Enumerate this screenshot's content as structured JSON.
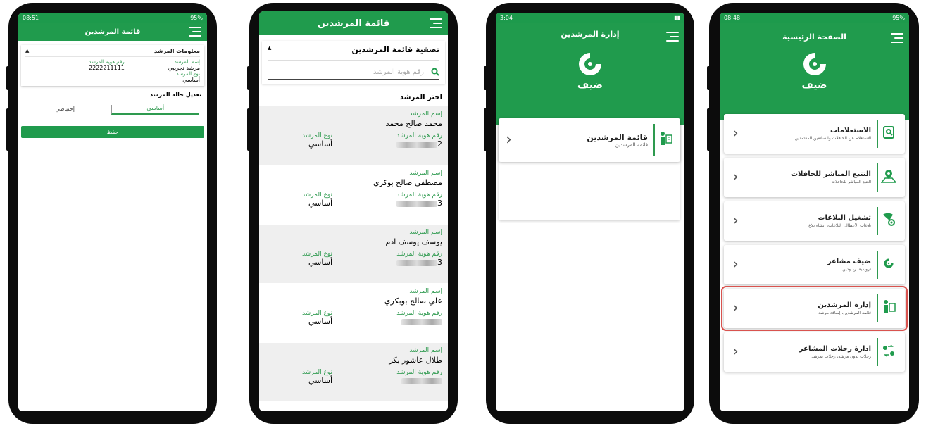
{
  "phone1": {
    "status": {
      "time": "08:51",
      "battery": "95%"
    },
    "title": "قائمة المرشدين",
    "info_title": "معلومات المرشد",
    "name_label": "إسم المرشد",
    "name_value": "مرشد تجريبي",
    "id_label": "رقم هوية المرشد",
    "id_value": "2222211111",
    "type_label": "نوع المرشد",
    "type_value": "أساسي",
    "edit_title": "تعديل حالة المرشد",
    "opt_primary": "أساسي",
    "opt_backup": "إحتياطي",
    "save": "حفظ"
  },
  "phone2": {
    "title": "قائمة المرشدين",
    "filter_title": "تصفية قائمة المرشدين",
    "search_placeholder": "رقم هوية المرشد",
    "choose": "اختر المرشد",
    "name_label": "إسم المرشد",
    "id_label": "رقم هوية المرشد",
    "type_label": "نوع المرشد",
    "items": [
      {
        "name": "محمد صالح محمد",
        "id_tail": "2",
        "type": "أساسي"
      },
      {
        "name": "مصطفى صالح بوكري",
        "id_tail": "3",
        "type": "أساسي"
      },
      {
        "name": "يوسف يوسف ادم",
        "id_tail": "3",
        "type": "أساسي"
      },
      {
        "name": "علي صالح بوبكري",
        "id_tail": "",
        "type": "أساسي"
      },
      {
        "name": "طلال عاشور بكر",
        "id_tail": "",
        "type": "أساسي"
      }
    ]
  },
  "phone3": {
    "status": {
      "time": "3:04"
    },
    "title": "إدارة المرشدين",
    "logo_text": "ضيف",
    "card_title": "قائمة المرشدين",
    "card_sub": "قائمة المرشدين"
  },
  "phone4": {
    "status": {
      "time": "08:48",
      "battery": "95%"
    },
    "title": "الصفحة الرئيسية",
    "logo_text": "ضيف",
    "items": [
      {
        "title": "الاستعلامات",
        "sub": "الاستعلام عن الحافلات والسائقين المعتمدين ....",
        "icon": "search-doc-icon"
      },
      {
        "title": "التتبع المباشر للحافلات",
        "sub": "التتبع المباشر للحافلات",
        "icon": "map-pin-icon"
      },
      {
        "title": "تشغيل البلاغات",
        "sub": "بلاغات الأعطال، البلاغات، انشاء بلاغ",
        "icon": "gear-report-icon"
      },
      {
        "title": "ضيف مشاعر",
        "sub": "ترويدية، رد ودين",
        "icon": "app-logo-icon"
      },
      {
        "title": "إدارة المرشدين",
        "sub": "قائمة المرشدين، إضافة مرشد",
        "icon": "guide-person-icon"
      },
      {
        "title": "ادارة رحلات المشاعر",
        "sub": "رحلات بدون مرشد، رحلات بمرشد",
        "icon": "trips-icon"
      }
    ]
  },
  "colors": {
    "brand_green": "#209b4d",
    "highlight_red": "#d9534f"
  }
}
